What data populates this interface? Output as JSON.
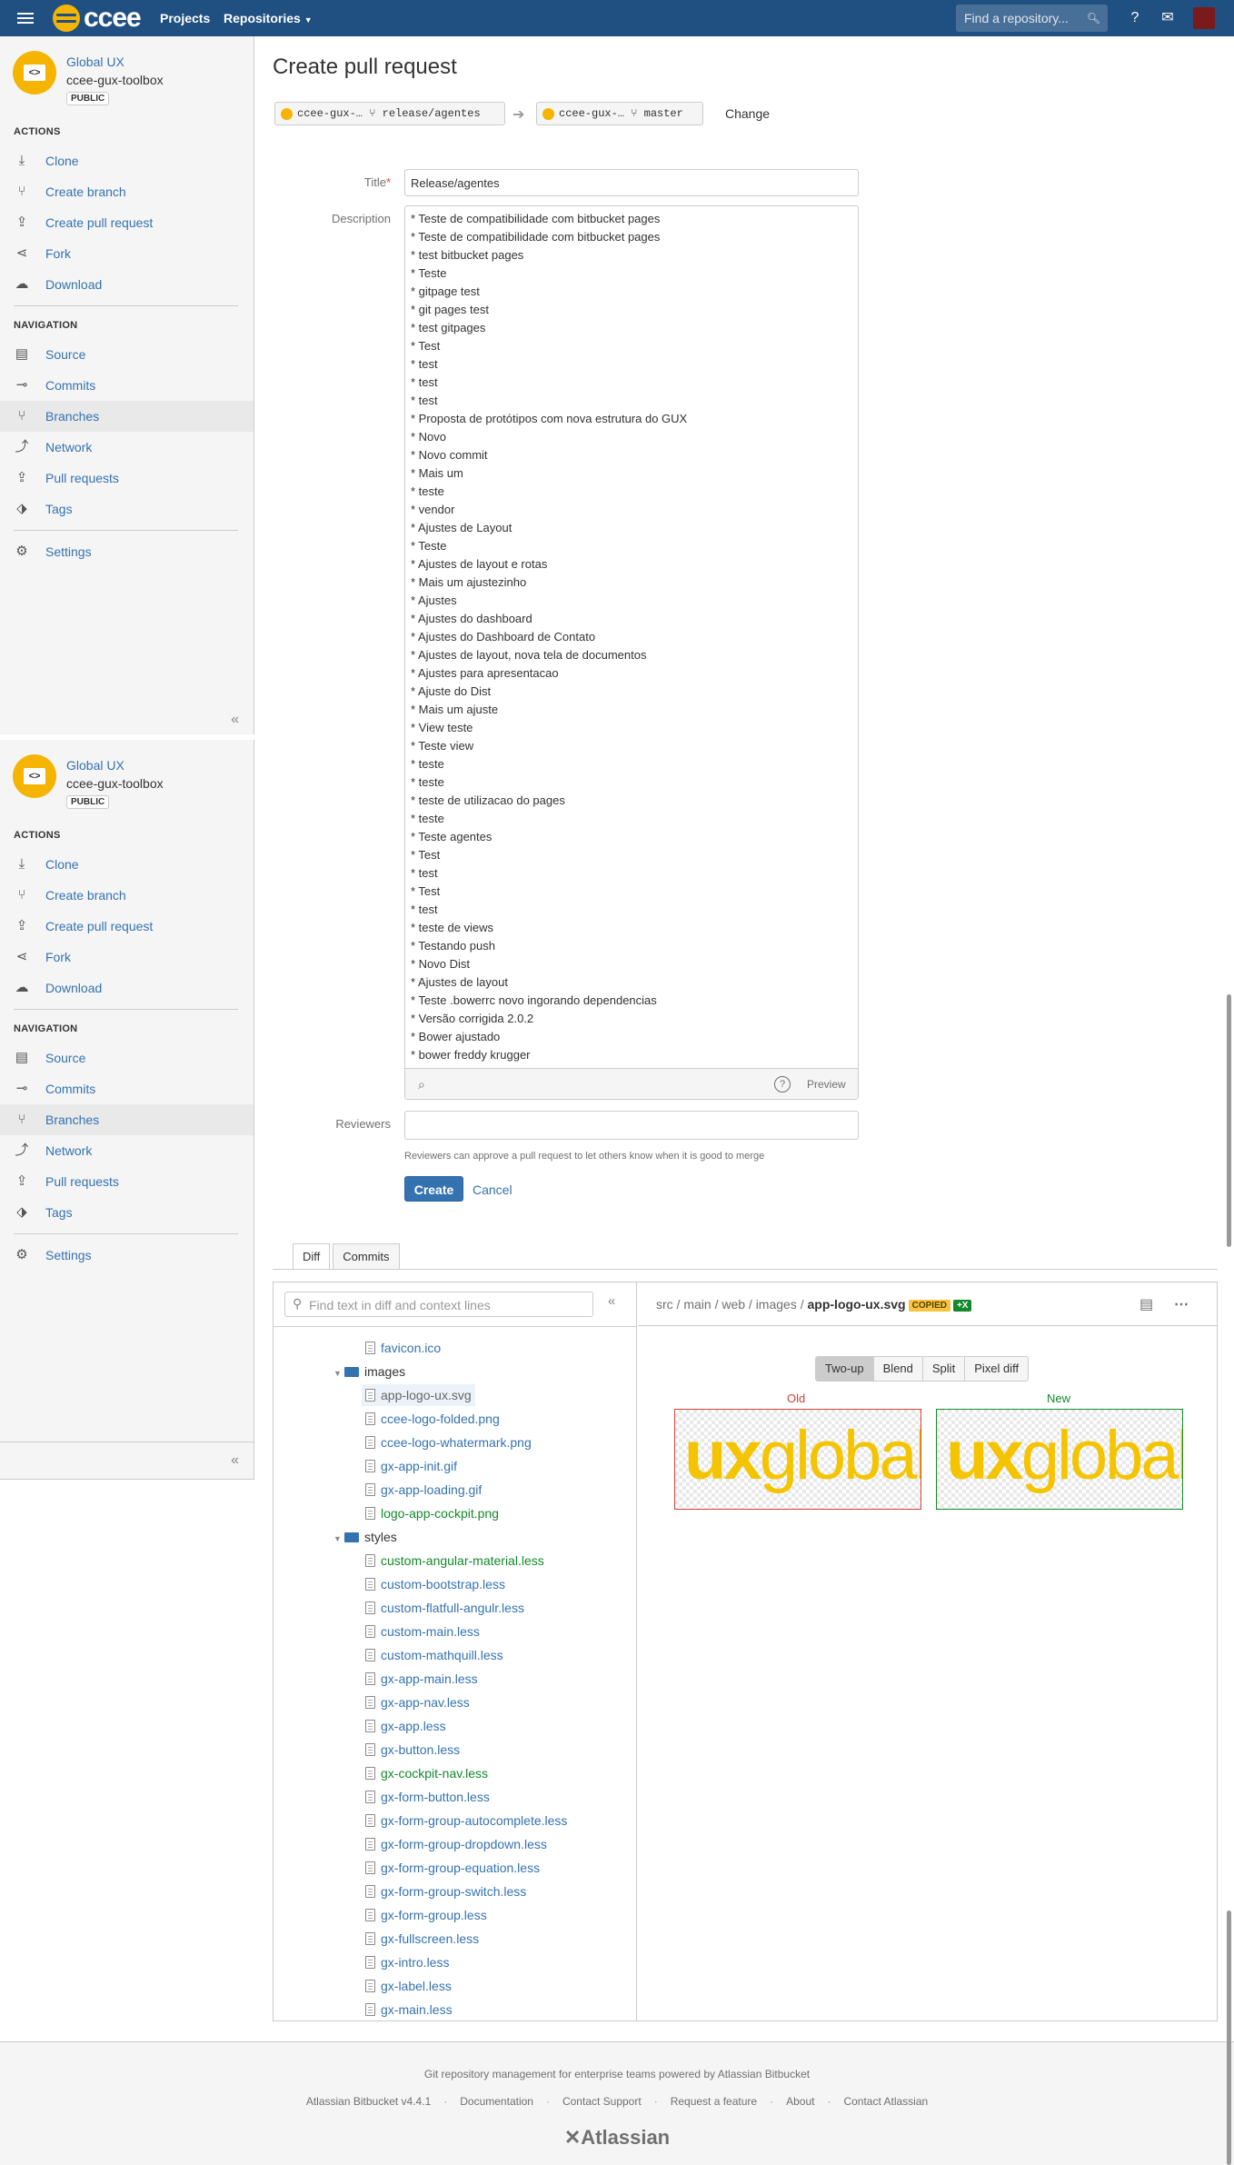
{
  "topbar": {
    "logo_text": "ccee",
    "nav": [
      "Projects",
      "Repositories"
    ],
    "search_placeholder": "Find a repository...",
    "brand_color": "#205081"
  },
  "sidebar": {
    "project": "Global UX",
    "repo": "ccee-gux-toolbox",
    "badge": "PUBLIC",
    "actions_heading": "ACTIONS",
    "actions": [
      {
        "label": "Clone",
        "icon": "download-icon"
      },
      {
        "label": "Create branch",
        "icon": "branch-icon"
      },
      {
        "label": "Create pull request",
        "icon": "pull-request-icon"
      },
      {
        "label": "Fork",
        "icon": "fork-icon"
      },
      {
        "label": "Download",
        "icon": "cloud-download-icon"
      }
    ],
    "navigation_heading": "NAVIGATION",
    "navigation": [
      {
        "label": "Source",
        "icon": "file-icon"
      },
      {
        "label": "Commits",
        "icon": "commit-icon"
      },
      {
        "label": "Branches",
        "icon": "branches-icon"
      },
      {
        "label": "Network",
        "icon": "network-icon"
      },
      {
        "label": "Pull requests",
        "icon": "pull-request-icon"
      },
      {
        "label": "Tags",
        "icon": "tag-icon"
      }
    ],
    "settings": "Settings"
  },
  "page": {
    "title": "Create pull request",
    "change": "Change",
    "source_repo": "ccee-gux-…",
    "source_branch": "release/agentes",
    "target_repo": "ccee-gux-…",
    "target_branch": "master"
  },
  "form": {
    "title_label": "Title",
    "title_value": "Release/agentes",
    "description_label": "Description",
    "description_lines": [
      "* Teste de compatibilidade com bitbucket pages",
      "* Teste de compatibilidade com bitbucket pages",
      "* test bitbucket pages",
      "* Teste",
      "* gitpage test",
      "* git pages test",
      "* test gitpages",
      "* Test",
      "* test",
      "* test",
      "* test",
      "* Proposta de protótipos com nova estrutura do GUX",
      "* Novo",
      "* Novo commit",
      "* Mais um",
      "* teste",
      "* vendor",
      "* Ajustes de Layout",
      "* Teste",
      "* Ajustes de layout e rotas",
      "* Mais um ajustezinho",
      "* Ajustes",
      "* Ajustes do dashboard",
      "* Ajustes do Dashboard de Contato",
      "* Ajustes de layout, nova tela de documentos",
      "* Ajustes para apresentacao",
      "* Ajuste do Dist",
      "* Mais um ajuste",
      "* View teste",
      "* Teste view",
      "* teste",
      "* teste",
      "* teste de utilizacao do pages",
      "* teste",
      "* Teste agentes",
      "* Test",
      "* test",
      "* Test",
      "* test",
      "* teste de views",
      "* Testando push",
      "* Novo Dist",
      "* Ajustes de layout",
      "* Teste .bowerrc novo ingorando dependencias",
      "* Versão corrigida 2.0.2",
      "* Bower ajustado",
      "* bower freddy krugger"
    ],
    "preview": "Preview",
    "reviewers_label": "Reviewers",
    "reviewers_help": "Reviewers can approve a pull request to let others know when it is good to merge",
    "create": "Create",
    "cancel": "Cancel"
  },
  "tabs": [
    "Diff",
    "Commits"
  ],
  "diff": {
    "search_placeholder": "Find text in diff and context lines",
    "path_prefix": "src / main / web / images / ",
    "file": "app-logo-ux.svg",
    "badge_copied": "COPIED",
    "badge_added": "+X",
    "modes": [
      "Two-up",
      "Blend",
      "Split",
      "Pixel diff"
    ],
    "old_label": "Old",
    "new_label": "New",
    "image_text_bold": "ux",
    "image_text": "global",
    "tree": [
      {
        "name": "favicon.ico",
        "type": "file",
        "status": "modified",
        "depth": 2
      },
      {
        "name": "images",
        "type": "folder",
        "depth": 1
      },
      {
        "name": "app-logo-ux.svg",
        "type": "file",
        "status": "selected",
        "depth": 2
      },
      {
        "name": "ccee-logo-folded.png",
        "type": "file",
        "status": "modified",
        "depth": 2
      },
      {
        "name": "ccee-logo-whatermark.png",
        "type": "file",
        "status": "modified",
        "depth": 2
      },
      {
        "name": "gx-app-init.gif",
        "type": "file",
        "status": "modified",
        "depth": 2
      },
      {
        "name": "gx-app-loading.gif",
        "type": "file",
        "status": "modified",
        "depth": 2
      },
      {
        "name": "logo-app-cockpit.png",
        "type": "file",
        "status": "added",
        "depth": 2
      },
      {
        "name": "styles",
        "type": "folder",
        "depth": 1
      },
      {
        "name": "custom-angular-material.less",
        "type": "file",
        "status": "added",
        "depth": 2
      },
      {
        "name": "custom-bootstrap.less",
        "type": "file",
        "status": "modified",
        "depth": 2
      },
      {
        "name": "custom-flatfull-angulr.less",
        "type": "file",
        "status": "modified",
        "depth": 2
      },
      {
        "name": "custom-main.less",
        "type": "file",
        "status": "modified",
        "depth": 2
      },
      {
        "name": "custom-mathquill.less",
        "type": "file",
        "status": "modified",
        "depth": 2
      },
      {
        "name": "gx-app-main.less",
        "type": "file",
        "status": "modified",
        "depth": 2
      },
      {
        "name": "gx-app-nav.less",
        "type": "file",
        "status": "modified",
        "depth": 2
      },
      {
        "name": "gx-app.less",
        "type": "file",
        "status": "modified",
        "depth": 2
      },
      {
        "name": "gx-button.less",
        "type": "file",
        "status": "modified",
        "depth": 2
      },
      {
        "name": "gx-cockpit-nav.less",
        "type": "file",
        "status": "added",
        "depth": 2
      },
      {
        "name": "gx-form-button.less",
        "type": "file",
        "status": "modified",
        "depth": 2
      },
      {
        "name": "gx-form-group-autocomplete.less",
        "type": "file",
        "status": "modified",
        "depth": 2
      },
      {
        "name": "gx-form-group-dropdown.less",
        "type": "file",
        "status": "modified",
        "depth": 2
      },
      {
        "name": "gx-form-group-equation.less",
        "type": "file",
        "status": "modified",
        "depth": 2
      },
      {
        "name": "gx-form-group-switch.less",
        "type": "file",
        "status": "modified",
        "depth": 2
      },
      {
        "name": "gx-form-group.less",
        "type": "file",
        "status": "modified",
        "depth": 2
      },
      {
        "name": "gx-fullscreen.less",
        "type": "file",
        "status": "modified",
        "depth": 2
      },
      {
        "name": "gx-intro.less",
        "type": "file",
        "status": "modified",
        "depth": 2
      },
      {
        "name": "gx-label.less",
        "type": "file",
        "status": "modified",
        "depth": 2
      },
      {
        "name": "gx-main.less",
        "type": "file",
        "status": "modified",
        "depth": 2
      }
    ]
  },
  "footer": {
    "tagline": "Git repository management for enterprise teams powered by Atlassian Bitbucket",
    "links": [
      "Atlassian Bitbucket v4.4.1",
      "Documentation",
      "Contact Support",
      "Request a feature",
      "About",
      "Contact Atlassian"
    ],
    "logo": "Atlassian"
  }
}
